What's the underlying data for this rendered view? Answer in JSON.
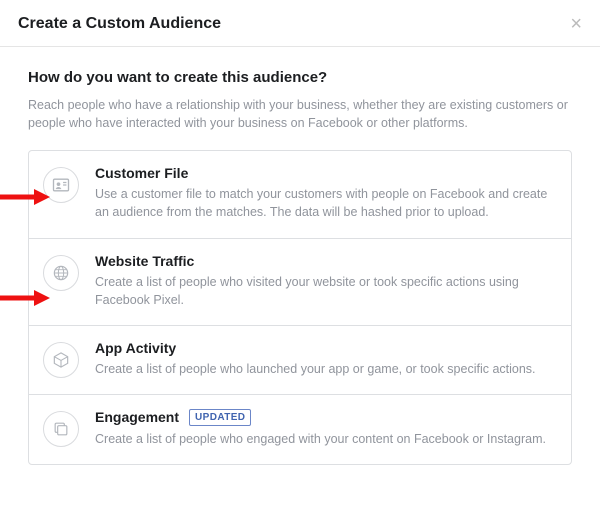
{
  "header": {
    "title": "Create a Custom Audience",
    "close_glyph": "×"
  },
  "intro": {
    "question": "How do you want to create this audience?",
    "description": "Reach people who have a relationship with your business, whether they are existing customers or people who have interacted with your business on Facebook or other platforms."
  },
  "badge": {
    "updated": "UPDATED"
  },
  "options": [
    {
      "title": "Customer File",
      "description": "Use a customer file to match your customers with people on Facebook and create an audience from the matches. The data will be hashed prior to upload."
    },
    {
      "title": "Website Traffic",
      "description": "Create a list of people who visited your website or took specific actions using Facebook Pixel."
    },
    {
      "title": "App Activity",
      "description": "Create a list of people who launched your app or game, or took specific actions."
    },
    {
      "title": "Engagement",
      "description": "Create a list of people who engaged with your content on Facebook or Instagram."
    }
  ]
}
